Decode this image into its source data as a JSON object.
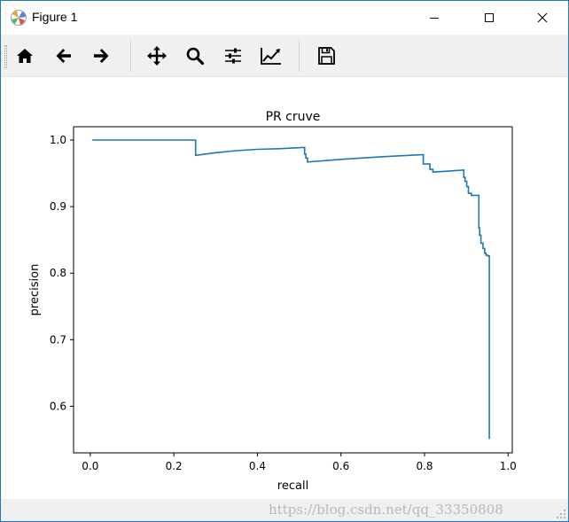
{
  "window": {
    "title": "Figure 1",
    "icon": "matplotlib-icon"
  },
  "window_controls": {
    "minimize_icon": "minimize-icon",
    "maximize_icon": "maximize-icon",
    "close_icon": "close-icon"
  },
  "toolbar": {
    "items": [
      {
        "name": "home-button",
        "icon": "home-icon"
      },
      {
        "name": "back-button",
        "icon": "arrow-left-icon"
      },
      {
        "name": "forward-button",
        "icon": "arrow-right-icon"
      },
      {
        "name": "pan-button",
        "icon": "move-arrows-icon"
      },
      {
        "name": "zoom-button",
        "icon": "magnifier-icon"
      },
      {
        "name": "subplots-button",
        "icon": "sliders-icon"
      },
      {
        "name": "customize-button",
        "icon": "line-chart-icon"
      },
      {
        "name": "save-button",
        "icon": "floppy-disk-icon"
      }
    ]
  },
  "statusbar": {
    "watermark": "https://blog.csdn.net/qq_33350808"
  },
  "colors": {
    "line": "#1f77b4",
    "toolbar_bg": "#f0f0f0",
    "window_border": "#1d77c9"
  },
  "chart_data": {
    "type": "line",
    "title": "PR cruve",
    "xlabel": "recall",
    "ylabel": "precision",
    "xlim": [
      -0.04,
      1.01
    ],
    "ylim": [
      0.53,
      1.02
    ],
    "xticks": [
      0.0,
      0.2,
      0.4,
      0.6,
      0.8,
      1.0
    ],
    "xtick_labels": [
      "0.0",
      "0.2",
      "0.4",
      "0.6",
      "0.8",
      "1.0"
    ],
    "yticks": [
      0.6,
      0.7,
      0.8,
      0.9,
      1.0
    ],
    "ytick_labels": [
      "0.6",
      "0.7",
      "0.8",
      "0.9",
      "1.0"
    ],
    "grid": false,
    "legend": "none",
    "series": [
      {
        "x": [
          0.005,
          0.252,
          0.252,
          0.3,
          0.35,
          0.4,
          0.45,
          0.513,
          0.513,
          0.516,
          0.516,
          0.52,
          0.52,
          0.6,
          0.7,
          0.797,
          0.797,
          0.813,
          0.813,
          0.82,
          0.82,
          0.85,
          0.894,
          0.894,
          0.897,
          0.897,
          0.901,
          0.901,
          0.905,
          0.905,
          0.912,
          0.912,
          0.93,
          0.93,
          0.932,
          0.932,
          0.935,
          0.935,
          0.94,
          0.94,
          0.944,
          0.944,
          0.947,
          0.947,
          0.951,
          0.951,
          0.955,
          0.955
        ],
        "y": [
          1.0,
          1.0,
          0.977,
          0.981,
          0.984,
          0.986,
          0.987,
          0.989,
          0.979,
          0.979,
          0.973,
          0.973,
          0.967,
          0.971,
          0.975,
          0.978,
          0.964,
          0.964,
          0.956,
          0.956,
          0.952,
          0.953,
          0.955,
          0.944,
          0.944,
          0.938,
          0.938,
          0.93,
          0.93,
          0.92,
          0.92,
          0.917,
          0.917,
          0.868,
          0.868,
          0.857,
          0.857,
          0.845,
          0.845,
          0.837,
          0.837,
          0.83,
          0.83,
          0.827,
          0.827,
          0.826,
          0.826,
          0.551
        ]
      }
    ]
  }
}
